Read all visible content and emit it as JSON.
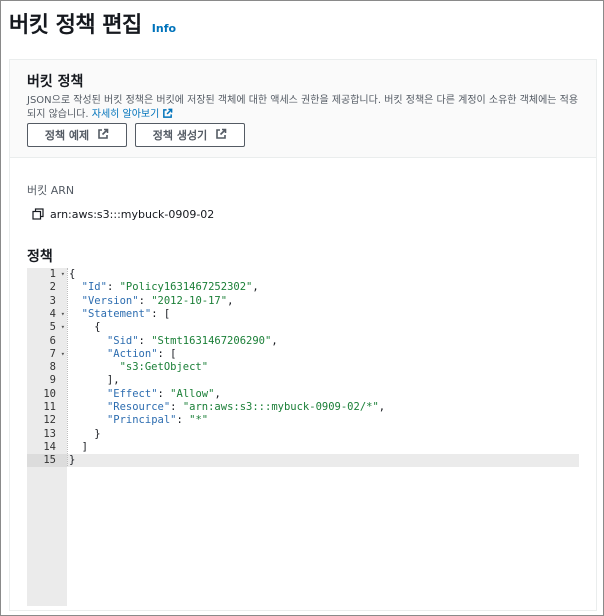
{
  "page": {
    "title": "버킷 정책 편집",
    "info_link": "Info"
  },
  "section": {
    "title": "버킷 정책",
    "description": "JSON으로 작성된 버킷 정책은 버킷에 저장된 객체에 대한 액세스 권한을 제공합니다. 버킷 정책은 다른 계정이 소유한 객체에는 적용되지 않습니다. ",
    "learn_more": "자세히 알아보기",
    "buttons": {
      "example": "정책 예제",
      "generator": "정책 생성기"
    }
  },
  "arn": {
    "label": "버킷 ARN",
    "value": "arn:aws:s3:::mybuck-0909-02"
  },
  "policy": {
    "label": "정책",
    "active_line": 15,
    "lines": [
      {
        "n": "1",
        "fold": "▾",
        "tokens": [
          [
            "p",
            "{"
          ]
        ]
      },
      {
        "n": "2",
        "fold": "",
        "tokens": [
          [
            "p",
            "  "
          ],
          [
            "k",
            "\"Id\""
          ],
          [
            "p",
            ": "
          ],
          [
            "s",
            "\"Policy1631467252302\""
          ],
          [
            "p",
            ","
          ]
        ]
      },
      {
        "n": "3",
        "fold": "",
        "tokens": [
          [
            "p",
            "  "
          ],
          [
            "k",
            "\"Version\""
          ],
          [
            "p",
            ": "
          ],
          [
            "s",
            "\"2012-10-17\""
          ],
          [
            "p",
            ","
          ]
        ]
      },
      {
        "n": "4",
        "fold": "▾",
        "tokens": [
          [
            "p",
            "  "
          ],
          [
            "k",
            "\"Statement\""
          ],
          [
            "p",
            ": ["
          ]
        ]
      },
      {
        "n": "5",
        "fold": "▾",
        "tokens": [
          [
            "p",
            "    {"
          ]
        ]
      },
      {
        "n": "6",
        "fold": "",
        "tokens": [
          [
            "p",
            "      "
          ],
          [
            "k",
            "\"Sid\""
          ],
          [
            "p",
            ": "
          ],
          [
            "s",
            "\"Stmt1631467206290\""
          ],
          [
            "p",
            ","
          ]
        ]
      },
      {
        "n": "7",
        "fold": "▾",
        "tokens": [
          [
            "p",
            "      "
          ],
          [
            "k",
            "\"Action\""
          ],
          [
            "p",
            ": ["
          ]
        ]
      },
      {
        "n": "8",
        "fold": "",
        "tokens": [
          [
            "p",
            "        "
          ],
          [
            "s",
            "\"s3:GetObject\""
          ]
        ]
      },
      {
        "n": "9",
        "fold": "",
        "tokens": [
          [
            "p",
            "      ],"
          ]
        ]
      },
      {
        "n": "10",
        "fold": "",
        "tokens": [
          [
            "p",
            "      "
          ],
          [
            "k",
            "\"Effect\""
          ],
          [
            "p",
            ": "
          ],
          [
            "s",
            "\"Allow\""
          ],
          [
            "p",
            ","
          ]
        ]
      },
      {
        "n": "11",
        "fold": "",
        "tokens": [
          [
            "p",
            "      "
          ],
          [
            "k",
            "\"Resource\""
          ],
          [
            "p",
            ": "
          ],
          [
            "s",
            "\"arn:aws:s3:::mybuck-0909-02/*\""
          ],
          [
            "p",
            ","
          ]
        ]
      },
      {
        "n": "12",
        "fold": "",
        "tokens": [
          [
            "p",
            "      "
          ],
          [
            "k",
            "\"Principal\""
          ],
          [
            "p",
            ": "
          ],
          [
            "s",
            "\"*\""
          ]
        ]
      },
      {
        "n": "13",
        "fold": "",
        "tokens": [
          [
            "p",
            "    }"
          ]
        ]
      },
      {
        "n": "14",
        "fold": "",
        "tokens": [
          [
            "p",
            "  ]"
          ]
        ]
      },
      {
        "n": "15",
        "fold": "",
        "tokens": [
          [
            "p",
            "}"
          ]
        ]
      }
    ]
  },
  "icons": {
    "external": "external-link-icon",
    "copy": "copy-icon"
  },
  "colors": {
    "link": "#0073bb",
    "json_key": "#2d6db0",
    "json_string": "#1a7f37"
  }
}
